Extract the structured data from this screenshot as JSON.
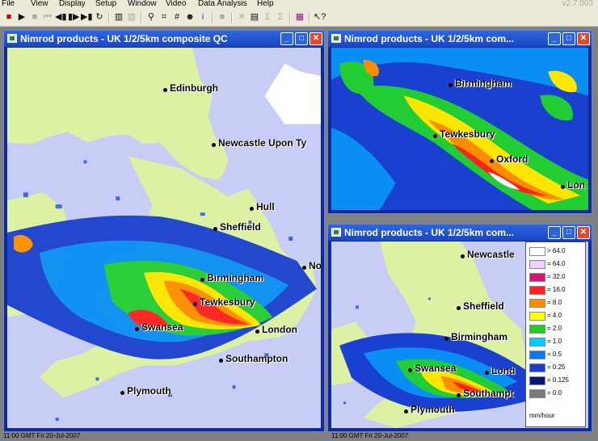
{
  "menu": [
    "File",
    "View",
    "Display",
    "Setup",
    "Window",
    "Video",
    "Data Analysis",
    "Help"
  ],
  "version": "v2.7.003",
  "toolbar": {
    "icons": [
      {
        "name": "record-icon",
        "glyph": "■",
        "color": "#b01010"
      },
      {
        "name": "play-icon",
        "glyph": "▶"
      },
      {
        "name": "stop-icon",
        "glyph": "■",
        "gray": true
      },
      {
        "name": "skip-back-icon",
        "glyph": "⏮",
        "gray": true
      },
      {
        "name": "step-back-icon",
        "glyph": "◀▮"
      },
      {
        "name": "step-forward-icon",
        "glyph": "▮▶"
      },
      {
        "name": "skip-forward-icon",
        "glyph": "▶▮"
      },
      {
        "name": "loop-icon",
        "glyph": "↻"
      },
      {
        "name": "bar-chart-icon",
        "glyph": "▥"
      },
      {
        "name": "bar-chart-gray-icon",
        "glyph": "▥",
        "gray": true
      },
      {
        "name": "zoom-icon",
        "glyph": "⚲"
      },
      {
        "name": "crop-icon",
        "glyph": "⌗"
      },
      {
        "name": "grid-icon",
        "glyph": "#"
      },
      {
        "name": "user-icon",
        "glyph": "☻"
      },
      {
        "name": "info-icon",
        "glyph": "i",
        "color": "#1a3ad6"
      },
      {
        "name": "stop-gray-icon",
        "glyph": "■",
        "gray": true
      },
      {
        "name": "cross-icon",
        "glyph": "✕",
        "gray": true
      },
      {
        "name": "image-icon",
        "glyph": "▤"
      },
      {
        "name": "sum-icon",
        "glyph": "Σ",
        "gray": true
      },
      {
        "name": "sum-y-icon",
        "glyph": "Σ",
        "gray": true
      },
      {
        "name": "palette-icon",
        "glyph": "▦",
        "color": "#8a1a8a"
      },
      {
        "name": "help-cursor-icon",
        "glyph": "↖?"
      }
    ]
  },
  "windows": {
    "main": {
      "title": "Nimrod products - UK 1/2/5km composite QC",
      "cities": [
        "Edinburgh",
        "Newcastle Upon Ty",
        "Hull",
        "Sheffield",
        "Birmingham",
        "Tewkesbury",
        "Swansea",
        "London",
        "Southampton",
        "Plymouth",
        "No"
      ],
      "status": "11:00 GMT Fri 20-Jul-2007"
    },
    "top_right": {
      "title": "Nimrod products - UK 1/2/5km com...",
      "cities": [
        "Birmingham",
        "Tewkesbury",
        "Oxford",
        "Lon"
      ]
    },
    "bottom_right": {
      "title": "Nimrod products - UK 1/2/5km com...",
      "cities": [
        "Newcastle",
        "Sheffield",
        "Birmingham",
        "Swansea",
        "Lond",
        "Southampt",
        "Plymouth"
      ],
      "status": "11:00 GMT Fri 20-Jul-2007"
    }
  },
  "legend": {
    "entries": [
      {
        "label": "> 64.0",
        "color": "#ffffff"
      },
      {
        "label": "= 64.0",
        "color": "#f0d0ff"
      },
      {
        "label": "= 32.0",
        "color": "#e01070"
      },
      {
        "label": "= 16.0",
        "color": "#ff2020"
      },
      {
        "label": "= 8.0",
        "color": "#ff8c00"
      },
      {
        "label": "= 4.0",
        "color": "#ffff00"
      },
      {
        "label": "= 2.0",
        "color": "#22cc22"
      },
      {
        "label": "= 1.0",
        "color": "#00ccff"
      },
      {
        "label": "= 0.5",
        "color": "#0a7af0"
      },
      {
        "label": "= 0.25",
        "color": "#1e3cd0"
      },
      {
        "label": "= 0.125",
        "color": "#0a1680"
      },
      {
        "label": "= 0.0",
        "color": "#7a7a7a"
      }
    ],
    "units": "mm/hour"
  }
}
